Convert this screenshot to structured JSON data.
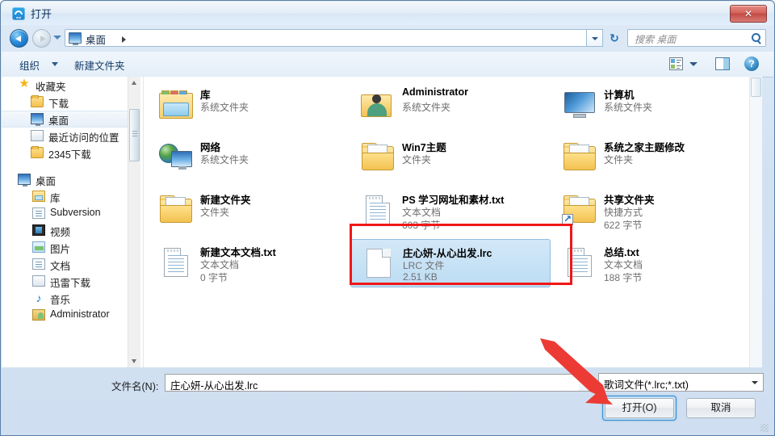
{
  "window": {
    "title": "打开",
    "title_icon": "kugou-music-icon",
    "close_label": "✕"
  },
  "nav": {
    "back_icon": "back-arrow-icon",
    "forward_icon": "forward-arrow-icon",
    "history_icon": "chevron-down-icon",
    "breadcrumb": "桌面",
    "breadcrumb_icon": "desktop-icon",
    "refresh_icon": "refresh-icon"
  },
  "search": {
    "placeholder": "搜索 桌面",
    "icon": "search-icon"
  },
  "toolbar": {
    "organize_label": "组织",
    "new_folder_label": "新建文件夹",
    "view_icon": "view-mode-icon",
    "preview_pane_icon": "preview-pane-icon",
    "help_icon": "help-icon"
  },
  "sidebar": {
    "groups": [
      {
        "header": {
          "label": "收藏夹",
          "icon": "star-icon"
        },
        "items": [
          {
            "label": "下载",
            "icon": "folder-icon",
            "selected": false
          },
          {
            "label": "桌面",
            "icon": "desktop-icon",
            "selected": true
          },
          {
            "label": "最近访问的位置",
            "icon": "recent-places-icon",
            "selected": false
          },
          {
            "label": "2345下载",
            "icon": "folder-icon",
            "selected": false
          }
        ]
      },
      {
        "header": {
          "label": "桌面",
          "icon": "desktop-icon"
        },
        "items": [
          {
            "label": "库",
            "icon": "library-icon",
            "selected": false
          },
          {
            "label": "Subversion",
            "icon": "document-icon",
            "selected": false
          },
          {
            "label": "视频",
            "icon": "video-icon",
            "selected": false
          },
          {
            "label": "图片",
            "icon": "picture-icon",
            "selected": false
          },
          {
            "label": "文档",
            "icon": "document-icon",
            "selected": false
          },
          {
            "label": "迅雷下载",
            "icon": "download-icon",
            "selected": false
          },
          {
            "label": "音乐",
            "icon": "music-note-icon",
            "selected": false
          },
          {
            "label": "Administrator",
            "icon": "user-folder-icon",
            "selected": false
          }
        ]
      }
    ],
    "scroll_up_icon": "scroll-up-icon",
    "scroll_down_icon": "scroll-down-icon"
  },
  "files": [
    {
      "name": "库",
      "type": "系统文件夹",
      "size": "",
      "icon": "library-folder-icon",
      "selected": false,
      "col": 0,
      "row": 0
    },
    {
      "name": "网络",
      "type": "系统文件夹",
      "size": "",
      "icon": "network-icon",
      "selected": false,
      "col": 0,
      "row": 1
    },
    {
      "name": "新建文件夹",
      "type": "文件夹",
      "size": "",
      "icon": "folder-icon",
      "selected": false,
      "col": 0,
      "row": 2
    },
    {
      "name": "新建文本文档.txt",
      "type": "文本文档",
      "size": "0 字节",
      "icon": "text-document-icon",
      "selected": false,
      "col": 0,
      "row": 3
    },
    {
      "name": "Administrator",
      "type": "系统文件夹",
      "size": "",
      "icon": "user-folder-icon",
      "selected": false,
      "col": 1,
      "row": 0
    },
    {
      "name": "Win7主题",
      "type": "文件夹",
      "size": "",
      "icon": "folder-icon",
      "selected": false,
      "col": 1,
      "row": 1
    },
    {
      "name": "PS 学习网址和素材.txt",
      "type": "文本文档",
      "size": "603 字节",
      "icon": "text-document-icon",
      "selected": false,
      "col": 1,
      "row": 2
    },
    {
      "name": "庄心妍-从心出发.lrc",
      "type": "LRC 文件",
      "size": "2.51 KB",
      "icon": "blank-document-icon",
      "selected": true,
      "col": 1,
      "row": 3
    },
    {
      "name": "计算机",
      "type": "系统文件夹",
      "size": "",
      "icon": "computer-icon",
      "selected": false,
      "col": 2,
      "row": 0
    },
    {
      "name": "系统之家主题修改",
      "type": "文件夹",
      "size": "",
      "icon": "folder-icon",
      "selected": false,
      "col": 2,
      "row": 1
    },
    {
      "name": "共享文件夹",
      "type": "快捷方式",
      "size": "622 字节",
      "icon": "folder-shortcut-icon",
      "selected": false,
      "col": 2,
      "row": 2
    },
    {
      "name": "总结.txt",
      "type": "文本文档",
      "size": "188 字节",
      "icon": "text-document-icon",
      "selected": false,
      "col": 2,
      "row": 3
    }
  ],
  "footer": {
    "filename_label": "文件名(N):",
    "filename_value": "庄心妍-从心出发.lrc",
    "filetype_value": "歌词文件(*.lrc;*.txt)",
    "open_button": "打开(O)",
    "cancel_button": "取消"
  },
  "annotations": {
    "highlight_color": "#f01717",
    "arrow_color": "#ec3b35",
    "highlight_target": "庄心妍-从心出发.lrc",
    "arrow_target": "打开(O)"
  }
}
